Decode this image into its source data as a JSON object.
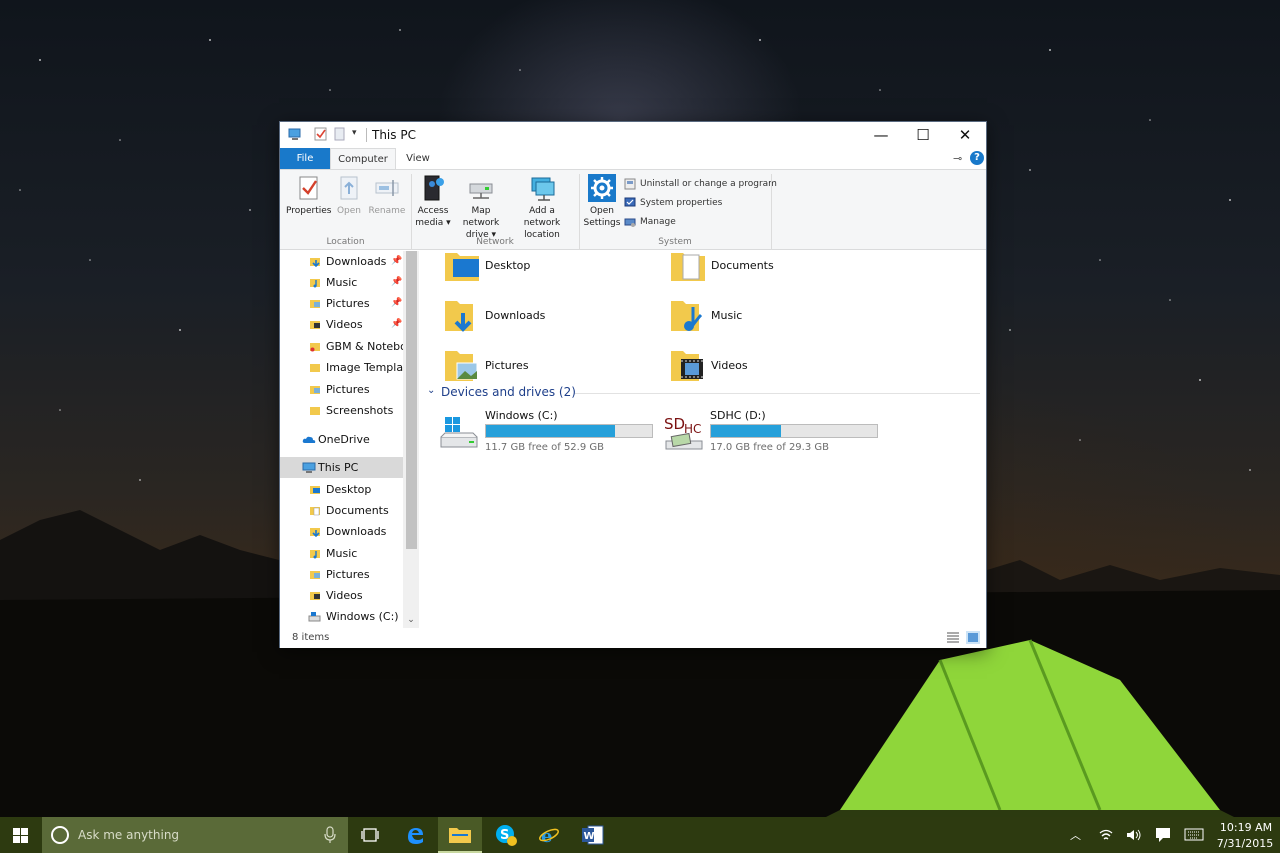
{
  "window": {
    "title": "This PC",
    "minimize": "—",
    "maximize": "☐",
    "close": "✕"
  },
  "ribbon": {
    "tabs": {
      "file": "File",
      "computer": "Computer",
      "view": "View"
    },
    "location": {
      "label": "Location",
      "properties": "Properties",
      "open": "Open",
      "rename": "Rename"
    },
    "network": {
      "label": "Network",
      "access_media_1": "Access",
      "access_media_2": "media ▾",
      "map_drive_1": "Map network",
      "map_drive_2": "drive ▾",
      "add_location_1": "Add a network",
      "add_location_2": "location"
    },
    "system": {
      "label": "System",
      "open_settings_1": "Open",
      "open_settings_2": "Settings",
      "uninstall": "Uninstall or change a program",
      "system_properties": "System properties",
      "manage": "Manage"
    }
  },
  "nav": {
    "quick_access": [
      {
        "label": "Downloads",
        "icon": "downloads-folder-icon",
        "pinned": true
      },
      {
        "label": "Music",
        "icon": "music-folder-icon",
        "pinned": true
      },
      {
        "label": "Pictures",
        "icon": "pictures-folder-icon",
        "pinned": true
      },
      {
        "label": "Videos",
        "icon": "videos-folder-icon",
        "pinned": true
      },
      {
        "label": "GBM & Noteboc",
        "icon": "folder-icon",
        "pinned": false
      },
      {
        "label": "Image Templates",
        "icon": "folder-icon",
        "pinned": false
      },
      {
        "label": "Pictures",
        "icon": "pictures-folder-icon",
        "pinned": false
      },
      {
        "label": "Screenshots",
        "icon": "folder-icon",
        "pinned": false
      }
    ],
    "onedrive": "OneDrive",
    "this_pc": "This PC",
    "this_pc_children": [
      {
        "label": "Desktop",
        "icon": "desktop-folder-icon"
      },
      {
        "label": "Documents",
        "icon": "documents-folder-icon"
      },
      {
        "label": "Downloads",
        "icon": "downloads-folder-icon"
      },
      {
        "label": "Music",
        "icon": "music-folder-icon"
      },
      {
        "label": "Pictures",
        "icon": "pictures-folder-icon"
      },
      {
        "label": "Videos",
        "icon": "videos-folder-icon"
      },
      {
        "label": "Windows (C:)",
        "icon": "drive-icon"
      }
    ]
  },
  "content": {
    "folders": [
      {
        "label": "Desktop",
        "icon": "desktop-folder-icon"
      },
      {
        "label": "Documents",
        "icon": "documents-folder-icon"
      },
      {
        "label": "Downloads",
        "icon": "downloads-folder-icon"
      },
      {
        "label": "Music",
        "icon": "music-folder-icon"
      },
      {
        "label": "Pictures",
        "icon": "pictures-folder-icon"
      },
      {
        "label": "Videos",
        "icon": "videos-folder-icon"
      }
    ],
    "devices_header": "Devices and drives (2)",
    "drives": [
      {
        "label": "Windows (C:)",
        "free": "11.7 GB free of 52.9 GB",
        "used_fraction": 0.779,
        "icon": "windows-drive-icon"
      },
      {
        "label": "SDHC (D:)",
        "free": "17.0 GB free of 29.3 GB",
        "used_fraction": 0.42,
        "icon": "sdhc-card-icon"
      }
    ]
  },
  "status": {
    "items": "8 items"
  },
  "taskbar": {
    "search_placeholder": "Ask me anything",
    "time": "10:19 AM",
    "date": "7/31/2015"
  },
  "colors": {
    "accent": "#1979ca",
    "drive_bar": "#26a0da",
    "taskbar": "#2d3a10"
  }
}
